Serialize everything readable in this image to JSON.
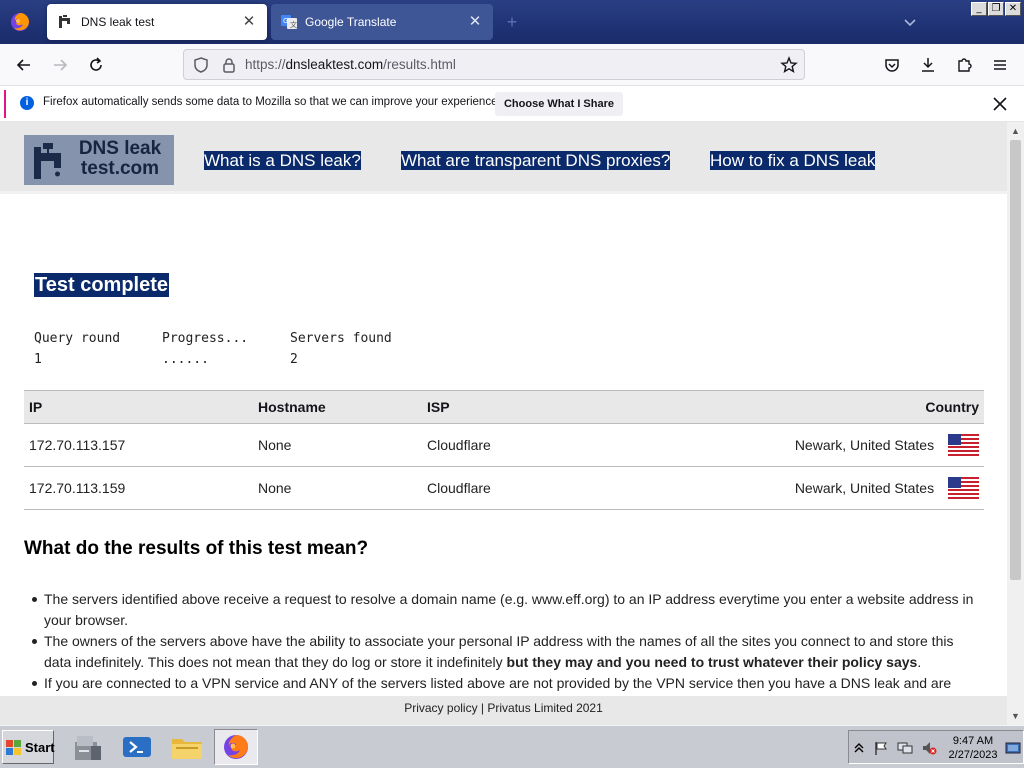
{
  "browser": {
    "tabs": [
      {
        "title": "DNS leak test",
        "active": true
      },
      {
        "title": "Google Translate",
        "active": false
      }
    ],
    "url_prefix": "https://",
    "url_host": "dnsleaktest.com",
    "url_path": "/results.html",
    "notification": {
      "text": "Firefox automatically sends some data to Mozilla so that we can improve your experience.",
      "button": "Choose What I Share"
    }
  },
  "site": {
    "logo_text_line1": "DNS leak",
    "logo_text_line2": "test.com",
    "nav": [
      "What is a DNS leak?",
      "What are transparent DNS proxies?",
      "How to fix a DNS leak"
    ]
  },
  "test": {
    "title": "Test complete",
    "stats": [
      {
        "label": "Query round",
        "value": "1"
      },
      {
        "label": "Progress...",
        "value": "......"
      },
      {
        "label": "Servers found",
        "value": "2"
      }
    ]
  },
  "results": {
    "columns": [
      "IP",
      "Hostname",
      "ISP",
      "Country"
    ],
    "rows": [
      {
        "ip": "172.70.113.157",
        "hostname": "None",
        "isp": "Cloudflare",
        "country": "Newark, United States"
      },
      {
        "ip": "172.70.113.159",
        "hostname": "None",
        "isp": "Cloudflare",
        "country": "Newark, United States"
      }
    ]
  },
  "explanation": {
    "heading": "What do the results of this test mean?",
    "items": [
      {
        "text": "The servers identified above receive a request to resolve a domain name (e.g. www.eff.org) to an IP address everytime you enter a website address in your browser.",
        "bold": ""
      },
      {
        "text": "The owners of the servers above have the ability to associate your personal IP address with the names of all the sites you connect to and store this data indefinitely. This does not mean that they do log or store it indefinitely ",
        "bold": "but they may and you need to trust whatever their policy says",
        "tail": "."
      },
      {
        "text": "If you are connected to a VPN service and ANY of the servers listed above are not provided by the VPN service then you have a DNS leak and are",
        "bold": ""
      }
    ]
  },
  "footer": {
    "privacy_link": "Privacy policy",
    "separator": " | ",
    "company": "Privatus Limited 2021"
  },
  "taskbar": {
    "start_label": "Start",
    "clock_time": "9:47 AM",
    "clock_date": "2/27/2023"
  },
  "colors": {
    "tabbar": "#1f3274",
    "site_highlight": "#0b2a6b",
    "site_header": "#e8e8e8",
    "logo_bg": "#8593ad",
    "notification_accent": "#e21587"
  }
}
